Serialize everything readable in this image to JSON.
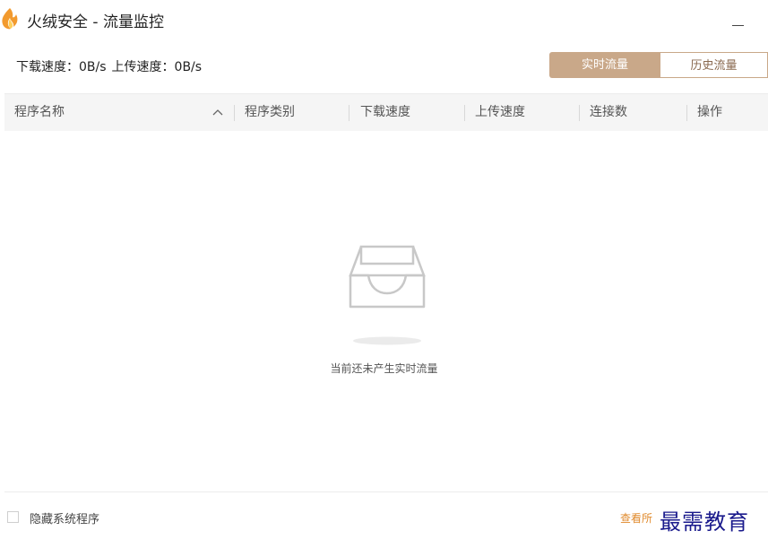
{
  "window": {
    "title": "火绒安全 - 流量监控",
    "minimize_label": "—"
  },
  "speed": {
    "download": "下载速度：0B/s",
    "upload": "上传速度：0B/s"
  },
  "tabs": [
    {
      "label": "实时流量",
      "active": true
    },
    {
      "label": "历史流量",
      "active": false
    }
  ],
  "table": {
    "columns": [
      "程序名称",
      "程序类别",
      "下载速度",
      "上传速度",
      "连接数",
      "操作"
    ],
    "sort_icon": "chevron-up-icon",
    "rows": []
  },
  "empty_state": {
    "icon": "empty-tray-icon",
    "message": "当前还未产生实时流量"
  },
  "footer": {
    "checkbox_label": "隐藏系统程序",
    "checkbox_checked": false,
    "link_text": "查看所"
  },
  "watermark": {
    "text": "最需教育"
  },
  "colors": {
    "accent": "#c9a889",
    "link": "#e08a2c",
    "logo": "#f29a2e"
  }
}
